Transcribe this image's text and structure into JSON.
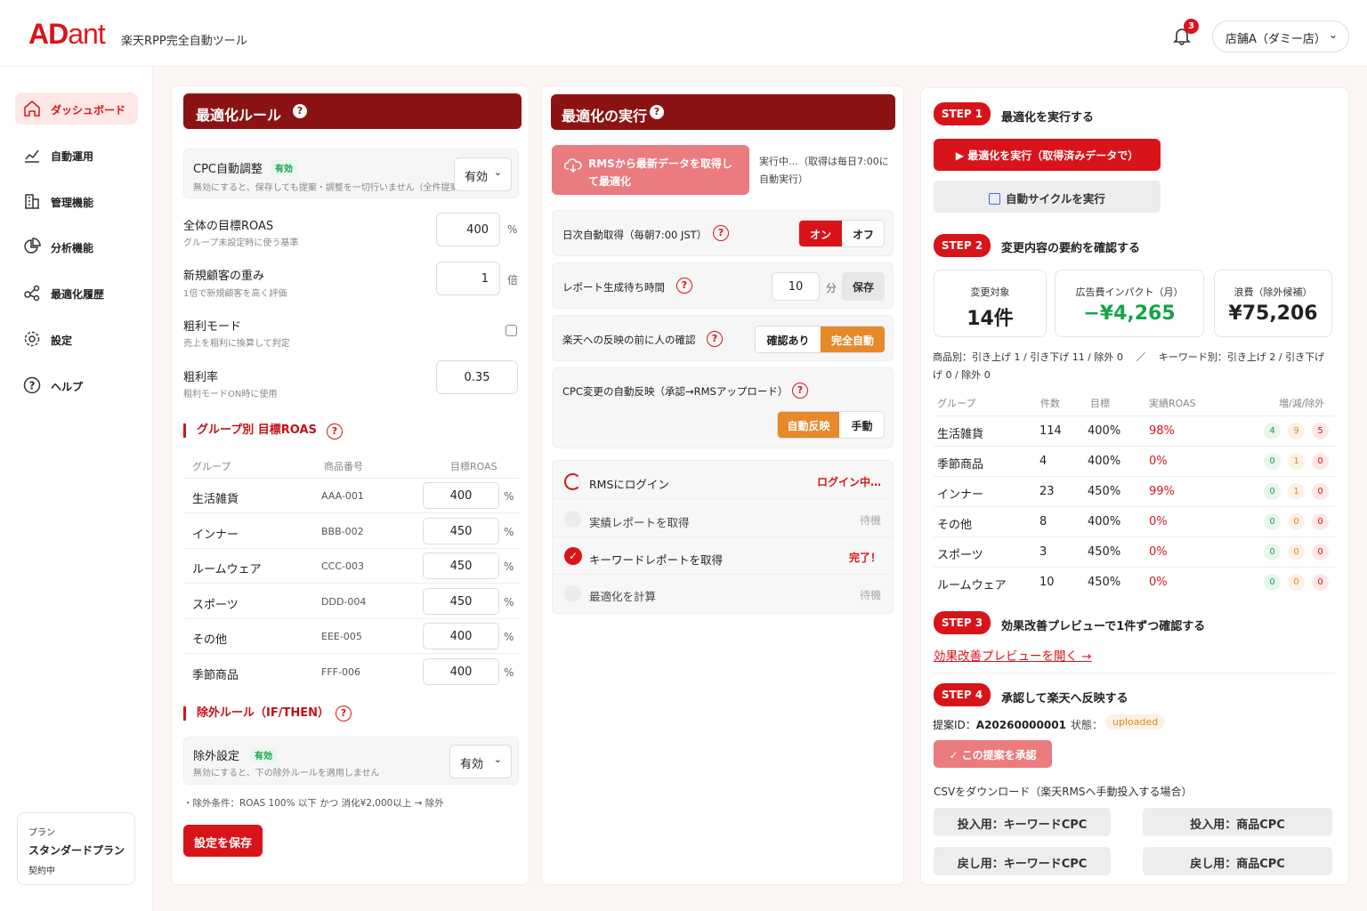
{
  "header": {
    "logo_ad": "AD",
    "logo_ant": "ant",
    "tagline": "楽天RPP完全自動ツール",
    "notifications": "3",
    "store": "店舗A（ダミー店）"
  },
  "sidebar": {
    "items": [
      {
        "label": "ダッシュボード",
        "icon": "home-icon"
      },
      {
        "label": "自動運用",
        "icon": "chart-line-icon"
      },
      {
        "label": "管理機能",
        "icon": "building-icon"
      },
      {
        "label": "分析機能",
        "icon": "pie-chart-icon"
      },
      {
        "label": "最適化履歴",
        "icon": "network-icon"
      },
      {
        "label": "設定",
        "icon": "gear-icon"
      },
      {
        "label": "ヘルプ",
        "icon": "help-icon"
      }
    ],
    "plan": {
      "label": "プラン",
      "name": "スタンダードプラン",
      "status": "契約中"
    }
  },
  "rules": {
    "title": "最適化ルール",
    "cpc_label": "CPC自動調整",
    "cpc_badge": "有効",
    "cpc_sub": "無効にすると、保存しても提案・調整を一切行いません（全件提案）",
    "cpc_value": "有効",
    "roas_label": "全体の目標ROAS",
    "roas_sub": "グループ未設定時に使う基準",
    "roas_value": "400",
    "roas_unit": "%",
    "newcust_label": "新規顧客の重み",
    "newcust_sub": "1倍で新規顧客を高く評価",
    "newcust_value": "1",
    "newcust_unit": "倍",
    "margin_label": "粗利モード",
    "margin_sub": "売上を粗利に換算して判定",
    "rate_label": "粗利率",
    "rate_sub": "粗利モードON時に使用",
    "rate_value": "0.35",
    "group_title": "グループ別 目標ROAS",
    "group_headers": [
      "グループ",
      "商品番号",
      "目標ROAS"
    ],
    "groups": [
      {
        "name": "生活雑貨",
        "code": "AAA-001",
        "roas": "400",
        "unit": "%"
      },
      {
        "name": "インナー",
        "code": "BBB-002",
        "roas": "450",
        "unit": "%"
      },
      {
        "name": "ルームウェア",
        "code": "CCC-003",
        "roas": "450",
        "unit": "%"
      },
      {
        "name": "スポーツ",
        "code": "DDD-004",
        "roas": "450",
        "unit": "%"
      },
      {
        "name": "その他",
        "code": "EEE-005",
        "roas": "400",
        "unit": "%"
      },
      {
        "name": "季節商品",
        "code": "FFF-006",
        "roas": "400",
        "unit": "%"
      }
    ],
    "excl_title": "除外ルール（IF/THEN）",
    "excl_label": "除外設定",
    "excl_badge": "有効",
    "excl_sub": "無効にすると、下の除外ルールを適用しません",
    "excl_value": "有効",
    "excl_cond": "・除外条件：ROAS 100% 以下 かつ 消化¥2,000以上 → 除外",
    "save": "設定を保存"
  },
  "exec": {
    "title": "最適化の実行",
    "fetch_btn": "RMSから最新データを取得して最適化",
    "running": "実行中…（取得は毎日7:00に自動実行）",
    "daily_label": "日次自動取得（毎朝7:00 JST）",
    "daily_on": "オン",
    "daily_off": "オフ",
    "wait_label": "レポート生成待ち時間",
    "wait_value": "10",
    "wait_unit": "分",
    "wait_save": "保存",
    "confirm_label": "楽天への反映の前に人の確認",
    "confirm_a": "確認あり",
    "confirm_b": "完全自動",
    "cpc_reflect_label": "CPC変更の自動反映（承認→RMSアップロード）",
    "reflect_a": "自動反映",
    "reflect_b": "手動",
    "steps": [
      {
        "label": "RMSにログイン",
        "status": "ログイン中…"
      },
      {
        "label": "実績レポートを取得",
        "status": "待機"
      },
      {
        "label": "キーワードレポートを取得",
        "status": "完了！"
      },
      {
        "label": "最適化を計算",
        "status": "待機"
      }
    ]
  },
  "right": {
    "step1_pill": "STEP 1",
    "step1": "最適化を実行する",
    "run_btn": "▶ 最適化を実行（取得済みデータで）",
    "cycle_btn": "自動サイクルを実行",
    "step2_pill": "STEP 2",
    "step2": "変更内容の要約を確認する",
    "stats": [
      {
        "label": "変更対象",
        "value": "14件"
      },
      {
        "label": "広告費インパクト（月）",
        "value": "−¥4,265"
      },
      {
        "label": "浪費（除外候補）",
        "value": "¥75,206"
      }
    ],
    "summary1": "商品別：引き上げ 1 / 引き下げ 11 / 除外 0　 ／ 　キーワード別：引き上げ 2 / 引き下げ",
    "summary2": "げ 0 / 除外 0",
    "table_headers": [
      "グループ",
      "件数",
      "目標",
      "実績ROAS",
      "増/減/除外"
    ],
    "table": [
      {
        "group": "生活雑貨",
        "count": "114",
        "target": "400%",
        "actual": "98%",
        "inc": "4",
        "dec": "9",
        "exc": "5"
      },
      {
        "group": "季節商品",
        "count": "4",
        "target": "400%",
        "actual": "0%",
        "inc": "0",
        "dec": "1",
        "exc": "0"
      },
      {
        "group": "インナー",
        "count": "23",
        "target": "450%",
        "actual": "99%",
        "inc": "0",
        "dec": "1",
        "exc": "0"
      },
      {
        "group": "その他",
        "count": "8",
        "target": "400%",
        "actual": "0%",
        "inc": "0",
        "dec": "0",
        "exc": "0"
      },
      {
        "group": "スポーツ",
        "count": "3",
        "target": "450%",
        "actual": "0%",
        "inc": "0",
        "dec": "0",
        "exc": "0"
      },
      {
        "group": "ルームウェア",
        "count": "10",
        "target": "450%",
        "actual": "0%",
        "inc": "0",
        "dec": "0",
        "exc": "0"
      }
    ],
    "step3_pill": "STEP 3",
    "step3": "効果改善プレビューで1件ずつ確認する",
    "preview_link": "効果改善プレビューを開く →",
    "step4_pill": "STEP 4",
    "step4": "承認して楽天へ反映する",
    "proposal_label": "提案ID：",
    "proposal_id": "A20260000001",
    "state_label": "状態：",
    "state": "uploaded",
    "approve": "✓ この提案を承認",
    "csv_label": "CSVをダウンロード（楽天RMSへ手動投入する場合）",
    "csv_btns": [
      "投入用：キーワードCPC",
      "投入用：商品CPC",
      "戻し用：キーワードCPC",
      "戻し用：商品CPC"
    ]
  }
}
